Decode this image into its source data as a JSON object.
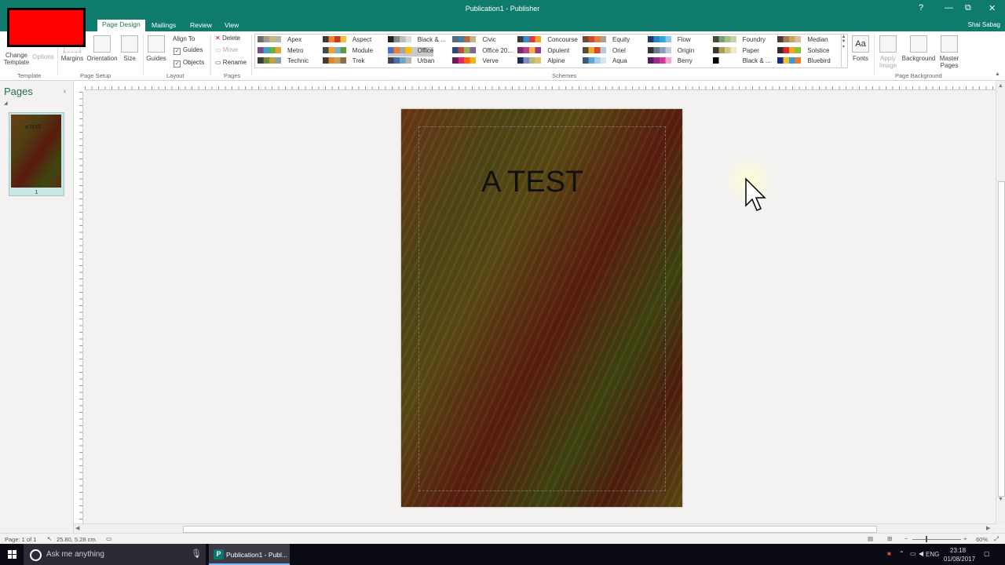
{
  "window": {
    "title": "Publication1 - Publisher",
    "user": "Shai Sabag",
    "help_glyph": "?",
    "restore_glyph": "⧉",
    "minimize_glyph": "—",
    "maximize_glyph": "▢",
    "close_glyph": "✕"
  },
  "tabs": [
    {
      "label": "Page Design",
      "active": true
    },
    {
      "label": "Mailings"
    },
    {
      "label": "Review"
    },
    {
      "label": "View"
    }
  ],
  "ribbon": {
    "template": {
      "change_label": "Change Template",
      "change_line1": "Change",
      "change_line2": "Template",
      "options_label": "Options",
      "group_label": "Template"
    },
    "page_setup": {
      "margins": "Margins",
      "orientation": "Orientation",
      "size": "Size",
      "group_label": "Page Setup"
    },
    "layout": {
      "guides": "Guides",
      "align_to": "Align To",
      "guides_check": "Guides",
      "objects_check": "Objects",
      "group_label": "Layout"
    },
    "pages": {
      "delete": "Delete",
      "move": "Move",
      "rename": "Rename",
      "group_label": "Pages"
    },
    "schemes": {
      "group_label": "Schemes",
      "items": [
        {
          "name": "Apex",
          "colors": [
            "#6c6c6c",
            "#a39d8b",
            "#c6b97d",
            "#b1b8a9"
          ]
        },
        {
          "name": "Metro",
          "colors": [
            "#7a4a8f",
            "#3ba1c7",
            "#61b04a",
            "#e7a039"
          ]
        },
        {
          "name": "Technic",
          "colors": [
            "#3b3b3b",
            "#6e8a3a",
            "#c2a23b",
            "#8d9da6"
          ]
        },
        {
          "name": "Aspect",
          "colors": [
            "#3a3a3a",
            "#f0832b",
            "#c43c26",
            "#f2c232"
          ]
        },
        {
          "name": "Module",
          "colors": [
            "#3c4a58",
            "#f0a126",
            "#7fb0d2",
            "#5e9a3c"
          ]
        },
        {
          "name": "Trek",
          "colors": [
            "#4a3a2a",
            "#e0862d",
            "#c2a35c",
            "#8a6c4b"
          ]
        },
        {
          "name": "Black & ...",
          "colors": [
            "#222222",
            "#888888",
            "#bbbbbb",
            "#dddddd"
          ]
        },
        {
          "name": "Office",
          "colors": [
            "#4472c4",
            "#ed7d31",
            "#a5a5a5",
            "#ffc000"
          ]
        },
        {
          "name": "Urban",
          "colors": [
            "#424456",
            "#4b6ea6",
            "#6aa6c6",
            "#b8b8b8"
          ]
        },
        {
          "name": "Civic",
          "colors": [
            "#5b6b7d",
            "#3d7fa2",
            "#b56b3c",
            "#c2b48d"
          ]
        },
        {
          "name": "Office 20...",
          "colors": [
            "#2a4b7c",
            "#bd4a49",
            "#94b64e",
            "#8064a2"
          ]
        },
        {
          "name": "Verve",
          "colors": [
            "#6b1b5b",
            "#e8266e",
            "#ff6600",
            "#f7b31a"
          ]
        },
        {
          "name": "Concourse",
          "colors": [
            "#3a3a3a",
            "#2f8fd3",
            "#db3e3e",
            "#f29f22"
          ]
        },
        {
          "name": "Opulent",
          "colors": [
            "#7b2a6e",
            "#b1438a",
            "#f6b03c",
            "#8f3a8c"
          ]
        },
        {
          "name": "Alpine",
          "colors": [
            "#1b2c5c",
            "#7c8ec3",
            "#b0be7a",
            "#e0c26a"
          ]
        },
        {
          "name": "Equity",
          "colors": [
            "#6b4a3a",
            "#d04a2b",
            "#e67a3a",
            "#a6a28a"
          ]
        },
        {
          "name": "Oriel",
          "colors": [
            "#5a4a3a",
            "#f0a526",
            "#d14c28",
            "#b9c9dc"
          ]
        },
        {
          "name": "Aqua",
          "colors": [
            "#3a5a7a",
            "#5ba9d6",
            "#a4cfe6",
            "#d5e6ef"
          ]
        },
        {
          "name": "Flow",
          "colors": [
            "#1a3b6b",
            "#2c7fd0",
            "#35a6d9",
            "#90c2e6"
          ]
        },
        {
          "name": "Origin",
          "colors": [
            "#333333",
            "#6b7a8a",
            "#8aa0b5",
            "#c0ccd8"
          ]
        },
        {
          "name": "Berry",
          "colors": [
            "#5a1a6b",
            "#9b2a8c",
            "#d4359b",
            "#f2a8d0"
          ]
        },
        {
          "name": "Foundry",
          "colors": [
            "#4a4a3a",
            "#7aa07a",
            "#a6c08a",
            "#c8d2a8"
          ]
        },
        {
          "name": "Paper",
          "colors": [
            "#3a3a2a",
            "#a8a05a",
            "#d6c88a",
            "#f0e8c8"
          ]
        },
        {
          "name": "Black & ...",
          "colors": [
            "#000000",
            "#ffffff",
            "#ffffff",
            "#ffffff"
          ]
        },
        {
          "name": "Median",
          "colors": [
            "#4a3a3a",
            "#a67a5a",
            "#c8a45a",
            "#d6c0a0"
          ]
        },
        {
          "name": "Solstice",
          "colors": [
            "#3a2a2a",
            "#e0252b",
            "#f0a526",
            "#85c13b"
          ]
        },
        {
          "name": "Bluebird",
          "colors": [
            "#1a2a8a",
            "#f0c22a",
            "#3a9ad6",
            "#f07a2a"
          ]
        }
      ]
    },
    "fonts": {
      "label": "Fonts",
      "glyph": "Aa"
    },
    "page_background": {
      "apply_image": "Apply Image",
      "background": "Background",
      "master_pages": "Master Pages",
      "group_label": "Page Background"
    }
  },
  "pages_pane": {
    "title": "Pages",
    "thumb_text": "A TEST",
    "page_number": "1",
    "collapse_glyph": "‹",
    "expand_glyph": "◢"
  },
  "publication": {
    "title_text": "A TEST"
  },
  "statusbar": {
    "page": "Page: 1 of 1",
    "position": "25.80, 5.28 cm.",
    "zoom": "60%"
  },
  "taskbar": {
    "search_placeholder": "Ask me anything",
    "app_label": "Publication1 - Publ...",
    "app_badge": "P",
    "lang": "ENG",
    "time": "23:18",
    "date": "01/08/2017"
  }
}
